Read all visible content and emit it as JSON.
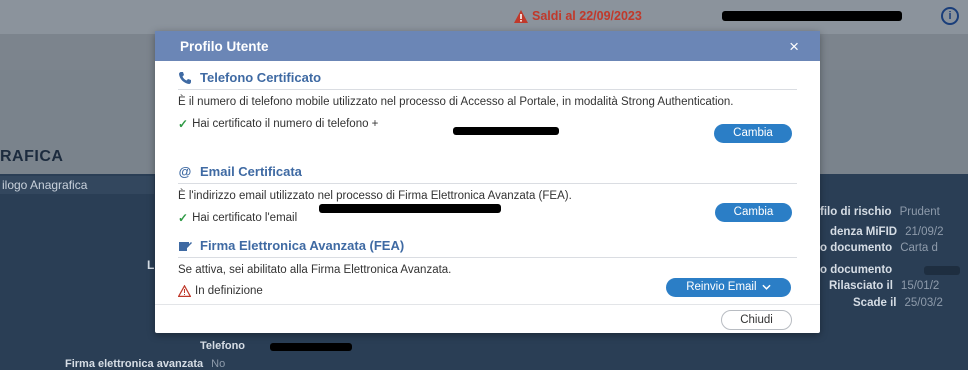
{
  "topbar": {
    "warning_text": "Saldi al 22/09/2023",
    "info_glyph": "i"
  },
  "background": {
    "section_title": "RAFICA",
    "tab_label": "ilogo Anagrafica",
    "lone_letter": "L",
    "side_rows": [
      {
        "label": "filo di rischio",
        "value": "Prudent"
      },
      {
        "label": "denza MiFID",
        "value": "21/09/2"
      },
      {
        "label": "o documento",
        "value": "Carta d"
      },
      {
        "label": "o documento",
        "value": ""
      },
      {
        "label": "Rilasciato il",
        "value": "15/01/2"
      },
      {
        "label": "Scade il",
        "value": "25/03/2"
      }
    ],
    "telefono_label": "Telefono",
    "fea_label": "Firma elettronica avanzata",
    "fea_value": "No"
  },
  "modal": {
    "title": "Profilo Utente",
    "close_glyph": "×",
    "phone": {
      "heading": "Telefono Certificato",
      "description": "È il numero di telefono mobile utilizzato nel processo di Accesso al Portale, in modalità Strong Authentication.",
      "status_text": "Hai certificato il numero di telefono +",
      "button": "Cambia"
    },
    "email": {
      "icon_glyph": "@",
      "heading": "Email Certificata",
      "description": "È l'indirizzo email utilizzato nel processo di Firma Elettronica Avanzata (FEA).",
      "status_text": "Hai certificato l'email",
      "button": "Cambia"
    },
    "fea": {
      "heading": "Firma Elettronica Avanzata (FEA)",
      "description": "Se attiva, sei abilitato alla Firma Elettronica Avanzata.",
      "status_text": "In definizione",
      "button": "Reinvio Email"
    },
    "close_button": "Chiudi"
  },
  "colors": {
    "modal_header": "#6b86b6",
    "accent": "#3f6aa3",
    "primary_button": "#2b7ec6",
    "success": "#2f9a45",
    "warning": "#c0392b"
  },
  "icons": [
    "warning-icon",
    "info-icon",
    "phone-icon",
    "at-icon",
    "signature-icon",
    "check-icon",
    "chevron-down-icon",
    "close-icon"
  ]
}
